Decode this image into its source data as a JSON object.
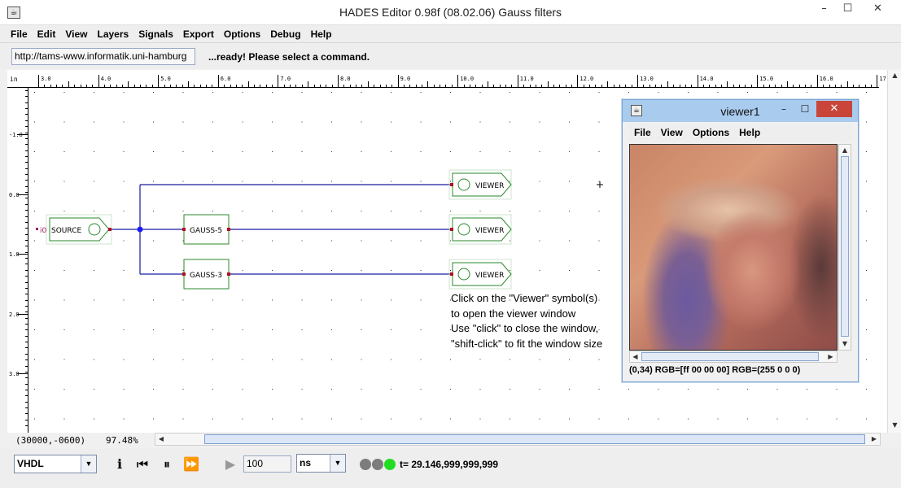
{
  "window": {
    "title": "HADES Editor 0.98f (08.02.06)   Gauss filters",
    "minimize": "–",
    "maximize": "☐",
    "close": "✕"
  },
  "menu": [
    "File",
    "Edit",
    "View",
    "Layers",
    "Signals",
    "Export",
    "Options",
    "Debug",
    "Help"
  ],
  "url": "http://tams-www.informatik.uni-hamburg",
  "status_message": "...ready! Please select a command.",
  "ruler": {
    "unit": "in",
    "h_labels": [
      "3.0",
      "4.0",
      "5.0",
      "6.0",
      "7.0",
      "8.0",
      "9.0",
      "10.0",
      "11.0",
      "12.0",
      "13.0",
      "14.0",
      "15.0",
      "16.0",
      "17"
    ],
    "v_labels": [
      "-1.0",
      "0.0",
      "1.0",
      "2.0",
      "3.0"
    ]
  },
  "schematic": {
    "input_pin": "i0",
    "source_label": "SOURCE",
    "gauss5_label": "GAUSS-5",
    "gauss3_label": "GAUSS-3",
    "viewer_label": "VIEWER",
    "instructions": [
      "Click on the \"Viewer\" symbol(s)",
      "to open the viewer window",
      "Use \"click\" to close the window,",
      "\"shift-click\" to fit the window size"
    ],
    "colors": {
      "wire": "#1a1aa0",
      "component": "#2a8a2a",
      "pin": "#b01020",
      "junction": "#1a1aff"
    }
  },
  "coords": "(30000,-0600)",
  "zoom": "97.48%",
  "bottom": {
    "language": "VHDL",
    "step_value": "100",
    "time_unit": "ns",
    "sim_time": "t= 29.146,999,999,999",
    "led_colors": [
      "#7d7d7d",
      "#7d7d7d",
      "#22dd22"
    ]
  },
  "viewer": {
    "title": "viewer1",
    "menu": [
      "File",
      "View",
      "Options",
      "Help"
    ],
    "status": "(0,34)   RGB=[ff 00 00 00]  RGB=(255 0 0 0)"
  }
}
